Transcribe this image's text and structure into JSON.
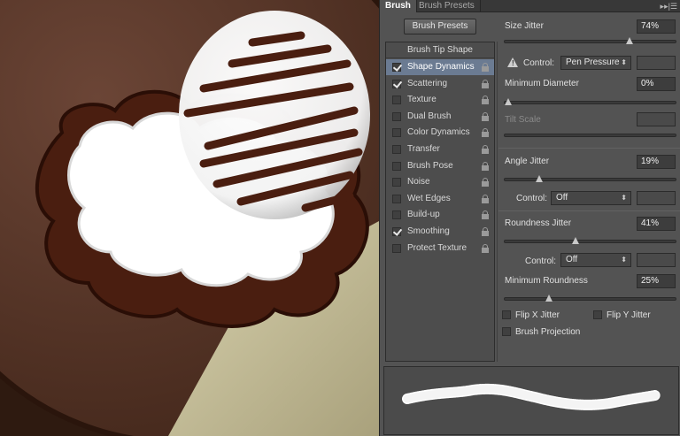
{
  "tabs": {
    "brush": "Brush",
    "presets": "Brush Presets",
    "menu": "▸▸|☰"
  },
  "presets_button": "Brush Presets",
  "list": {
    "header": "Brush Tip Shape",
    "items": [
      {
        "label": "Shape Dynamics",
        "checked": true,
        "selected": true
      },
      {
        "label": "Scattering",
        "checked": true,
        "selected": false
      },
      {
        "label": "Texture",
        "checked": false,
        "selected": false
      },
      {
        "label": "Dual Brush",
        "checked": false,
        "selected": false
      },
      {
        "label": "Color Dynamics",
        "checked": false,
        "selected": false
      },
      {
        "label": "Transfer",
        "checked": false,
        "selected": false
      },
      {
        "label": "Brush Pose",
        "checked": false,
        "selected": false
      },
      {
        "label": "Noise",
        "checked": false,
        "selected": false
      },
      {
        "label": "Wet Edges",
        "checked": false,
        "selected": false
      },
      {
        "label": "Build-up",
        "checked": false,
        "selected": false
      },
      {
        "label": "Smoothing",
        "checked": true,
        "selected": false
      },
      {
        "label": "Protect Texture",
        "checked": false,
        "selected": false
      }
    ]
  },
  "settings": {
    "size_jitter": {
      "label": "Size Jitter",
      "value": "74%",
      "level": 0.74
    },
    "size_control": {
      "label": "Control:",
      "value": "Pen Pressure"
    },
    "min_diameter": {
      "label": "Minimum Diameter",
      "value": "0%",
      "level": 0.0
    },
    "tilt_scale": {
      "label": "Tilt Scale"
    },
    "angle_jitter": {
      "label": "Angle Jitter",
      "value": "19%",
      "level": 0.19
    },
    "angle_control": {
      "label": "Control:",
      "value": "Off"
    },
    "roundness_jitter": {
      "label": "Roundness Jitter",
      "value": "41%",
      "level": 0.41
    },
    "roundness_control": {
      "label": "Control:",
      "value": "Off"
    },
    "min_roundness": {
      "label": "Minimum Roundness",
      "value": "25%",
      "level": 0.25
    },
    "flip_x": "Flip X Jitter",
    "flip_y": "Flip Y Jitter",
    "brush_projection": "Brush Projection"
  },
  "colors": {
    "panel": "#535353",
    "selection": "#6b7b92",
    "chocolate": "#4a1e10",
    "cream": "#c7c09a"
  }
}
